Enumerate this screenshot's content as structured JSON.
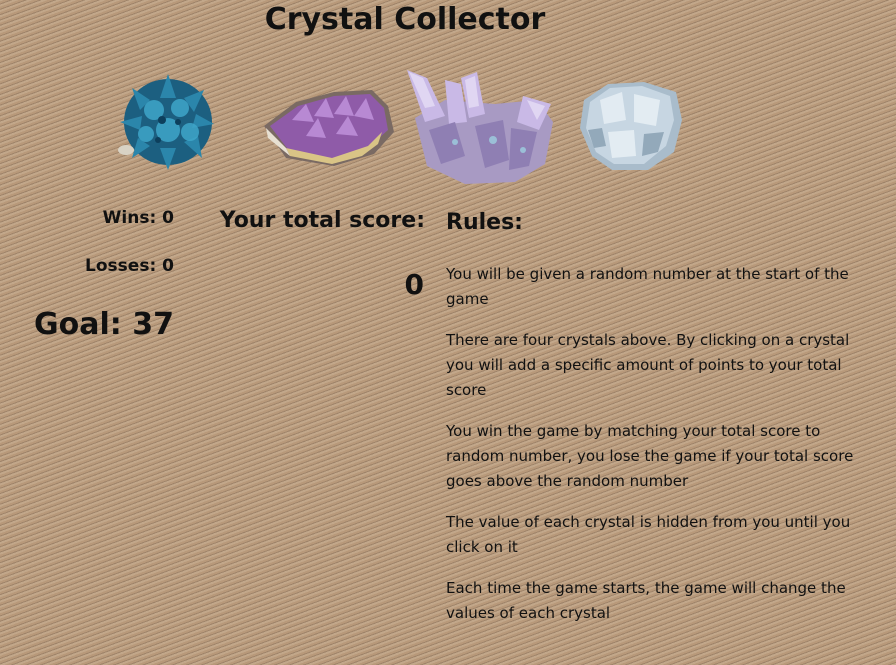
{
  "game": {
    "title": "Crystal Collector"
  },
  "crystals": [
    {
      "name": "blue-crystal",
      "color": "#1f6f93"
    },
    {
      "name": "amethyst-crystal",
      "color": "#9a6fb0"
    },
    {
      "name": "quartz-cluster-crystal",
      "color": "#b9a6d6"
    },
    {
      "name": "celestite-crystal",
      "color": "#b9cbd7"
    }
  ],
  "stats": {
    "wins": "Wins: 0",
    "losses": "Losses: 0",
    "goal": "Goal: 37"
  },
  "score": {
    "label": "Your total score:",
    "value": "0"
  },
  "rules": {
    "title": "Rules:",
    "items": [
      "You will be given a random number at the start of the game",
      "There are four crystals above. By clicking on a crystal you will add a specific amount of points to your total score",
      "You win the game by matching your total score to random number, you lose the game if your total score goes above the random number",
      "The value of each crystal is hidden from you until you click on it",
      "Each time the game starts, the game will change the values of each crystal"
    ]
  }
}
